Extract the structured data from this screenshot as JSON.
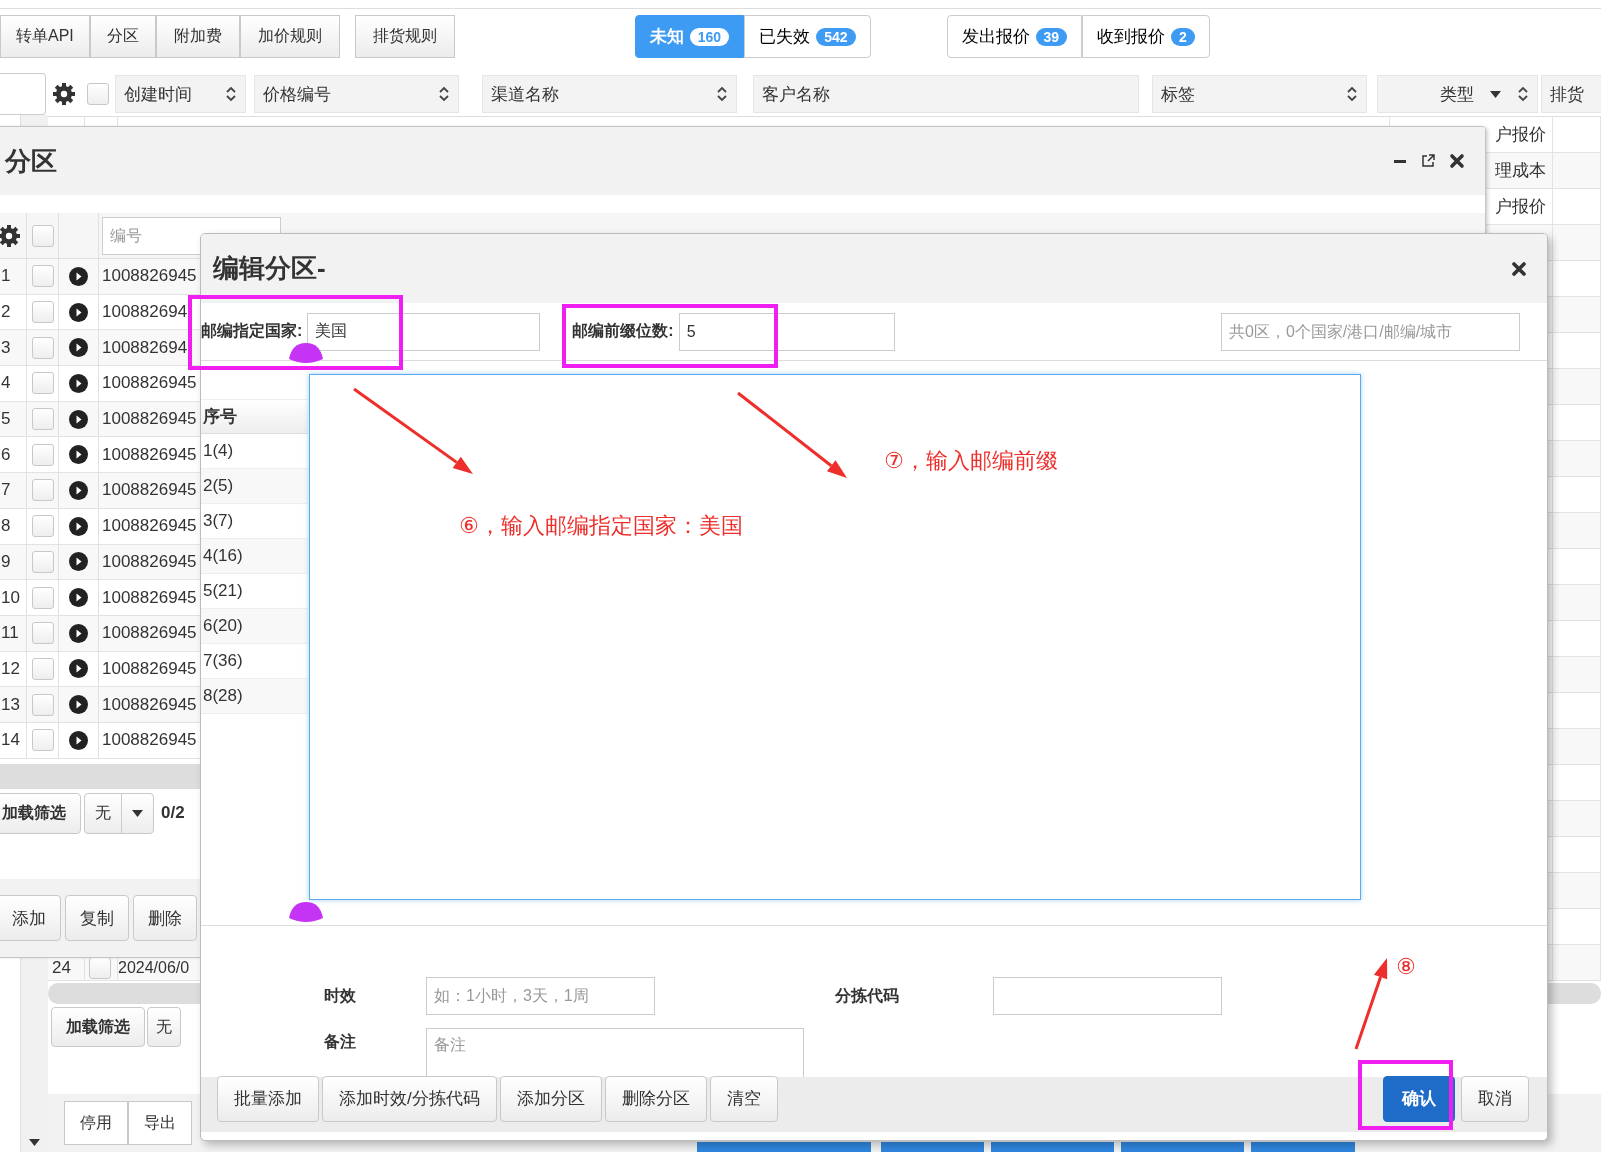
{
  "toolbar": {
    "nav_buttons": [
      "转单API",
      "分区",
      "附加费",
      "加价规则"
    ],
    "schedule_button": "排货规则",
    "status_tabs": [
      {
        "label": "未知",
        "count": "160",
        "selected": true
      },
      {
        "label": "已失效",
        "count": "542",
        "selected": false
      }
    ],
    "quote_tabs": [
      {
        "label": "发出报价",
        "count": "39",
        "selected": false
      },
      {
        "label": "收到报价",
        "count": "2",
        "selected": false
      }
    ]
  },
  "table": {
    "columns": [
      {
        "label": "创建时间",
        "sortable": true,
        "dropdown": false
      },
      {
        "label": "价格编号",
        "sortable": true,
        "dropdown": false
      },
      {
        "label": "渠道名称",
        "sortable": true,
        "dropdown": false
      },
      {
        "label": "客户名称",
        "sortable": false,
        "dropdown": false
      },
      {
        "label": "标签",
        "sortable": true,
        "dropdown": false
      },
      {
        "label": "类型",
        "sortable": true,
        "dropdown": true
      },
      {
        "label": "排货",
        "sortable": false,
        "dropdown": false
      }
    ],
    "rows": [
      {
        "type_text": "户报价"
      },
      {
        "type_text": "理成本"
      },
      {
        "type_text": "户报价"
      }
    ],
    "header_checked": false,
    "last_row": {
      "index": "24",
      "checked": false,
      "created": "2024/06/0"
    },
    "filter": {
      "button": "加载筛选",
      "select": "无"
    },
    "actions": [
      "停用",
      "导出"
    ]
  },
  "zone_window": {
    "title": "分区",
    "filter_placeholder": "编号",
    "header_checked": false,
    "rows": [
      {
        "index": "1",
        "checked": false,
        "code": "1008826945"
      },
      {
        "index": "2",
        "checked": false,
        "code": "100882694"
      },
      {
        "index": "3",
        "checked": false,
        "code": "100882694"
      },
      {
        "index": "4",
        "checked": false,
        "code": "1008826945"
      },
      {
        "index": "5",
        "checked": false,
        "code": "1008826945"
      },
      {
        "index": "6",
        "checked": false,
        "code": "1008826945"
      },
      {
        "index": "7",
        "checked": false,
        "code": "1008826945"
      },
      {
        "index": "8",
        "checked": false,
        "code": "1008826945"
      },
      {
        "index": "9",
        "checked": false,
        "code": "1008826945"
      },
      {
        "index": "10",
        "checked": false,
        "code": "1008826945"
      },
      {
        "index": "11",
        "checked": false,
        "code": "1008826945"
      },
      {
        "index": "12",
        "checked": false,
        "code": "1008826945"
      },
      {
        "index": "13",
        "checked": false,
        "code": "1008826945"
      },
      {
        "index": "14",
        "checked": false,
        "code": "1008826945"
      }
    ],
    "filter": {
      "button": "加载筛选",
      "select": "无",
      "count": "0/2"
    },
    "buttons": [
      "添加",
      "复制",
      "删除"
    ]
  },
  "dialog": {
    "title": "编辑分区-",
    "country": {
      "label": "邮编指定国家:",
      "value": "美国"
    },
    "prefix": {
      "label": "邮编前缀位数:",
      "value": "5"
    },
    "summary_placeholder": "共0区，0个国家/港口/邮编/城市",
    "list_header": "序号",
    "zones": [
      "1(4)",
      "2(5)",
      "3(7)",
      "4(16)",
      "5(21)",
      "6(20)",
      "7(36)",
      "8(28)"
    ],
    "aging": {
      "label": "时效",
      "placeholder": "如：1小时，3天，1周"
    },
    "sort_code": {
      "label": "分拣代码"
    },
    "remark": {
      "label": "备注",
      "placeholder": "备注"
    },
    "tool_buttons": [
      "批量添加",
      "添加时效/分拣代码",
      "添加分区",
      "删除分区",
      "清空"
    ],
    "confirm": "确认",
    "cancel": "取消"
  },
  "annotations": [
    {
      "text": "⑦，输入邮编前缀"
    },
    {
      "text": "⑥，输入邮编指定国家：美国"
    },
    {
      "text": "⑧"
    }
  ]
}
